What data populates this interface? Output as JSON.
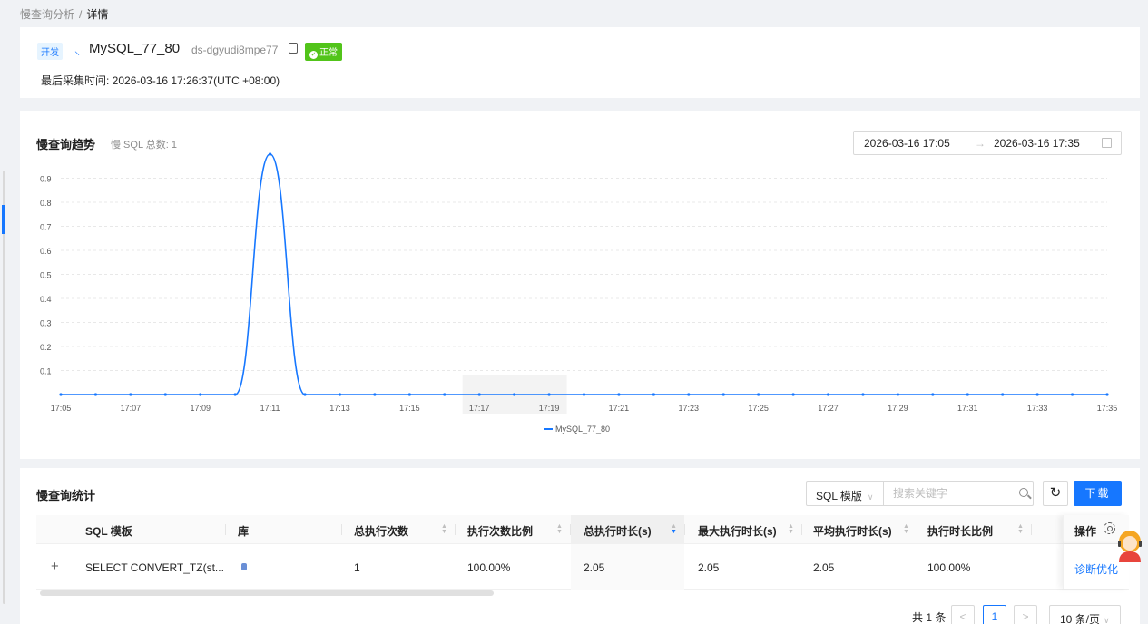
{
  "breadcrumb": {
    "parent": "慢查询分析",
    "separator": "/",
    "current": "详情"
  },
  "instance": {
    "env_tag": "开发",
    "name": "MySQL_77_80",
    "id": "ds-dgyudi8mpe77",
    "status": "正常",
    "collect_time": "最后采集时间: 2026-03-16 17:26:37(UTC +08:00)"
  },
  "trend": {
    "title": "慢查询趋势",
    "subtitle": "慢 SQL 总数: 1",
    "range_start": "2026-03-16 17:05",
    "range_arrow": "→",
    "range_end": "2026-03-16 17:35"
  },
  "chart_data": {
    "type": "line",
    "x": [
      "17:05",
      "17:06",
      "17:07",
      "17:08",
      "17:09",
      "17:10",
      "17:11",
      "17:12",
      "17:13",
      "17:14",
      "17:15",
      "17:16",
      "17:17",
      "17:18",
      "17:19",
      "17:20",
      "17:21",
      "17:22",
      "17:23",
      "17:24",
      "17:25",
      "17:26",
      "17:27",
      "17:28",
      "17:29",
      "17:30",
      "17:31",
      "17:32",
      "17:33",
      "17:34",
      "17:35"
    ],
    "x_ticks": [
      "17:05",
      "17:07",
      "17:09",
      "17:11",
      "17:13",
      "17:15",
      "17:17",
      "17:19",
      "17:21",
      "17:23",
      "17:25",
      "17:27",
      "17:29",
      "17:31",
      "17:33",
      "17:35"
    ],
    "series": [
      {
        "name": "MySQL_77_80",
        "values": [
          0,
          0,
          0,
          0,
          0,
          0,
          1,
          0,
          0,
          0,
          0,
          0,
          0,
          0,
          0,
          0,
          0,
          0,
          0,
          0,
          0,
          0,
          0,
          0,
          0,
          0,
          0,
          0,
          0,
          0,
          0
        ]
      }
    ],
    "y_ticks": [
      "0.1",
      "0.2",
      "0.3",
      "0.4",
      "0.5",
      "0.6",
      "0.7",
      "0.8",
      "0.9"
    ],
    "ylim": [
      0,
      1
    ],
    "grid": true,
    "legend_position": "bottom-center",
    "color": "#1677ff"
  },
  "stats": {
    "title": "慢查询统计",
    "filter_select": "SQL 模版",
    "search_placeholder": "搜索关键字",
    "download_label": "下载",
    "columns": [
      "SQL 模板",
      "库",
      "总执行次数",
      "执行次数比例",
      "总执行时长(s)",
      "最大执行时长(s)",
      "平均执行时长(s)",
      "执行时长比例",
      "操作"
    ],
    "rows": [
      {
        "expand": "+",
        "sql": "SELECT CONVERT_TZ(st...",
        "db": "",
        "exec_count": "1",
        "exec_ratio": "100.00%",
        "total_time": "2.05",
        "max_time": "2.05",
        "avg_time": "2.05",
        "time_ratio": "100.00%",
        "action": "诊断优化"
      }
    ],
    "pagination": {
      "total": "共 1 条",
      "prev": "<",
      "page": "1",
      "next": ">",
      "page_size": "10 条/页"
    }
  },
  "colors": {
    "primary": "#1677ff",
    "success": "#52c41a"
  }
}
